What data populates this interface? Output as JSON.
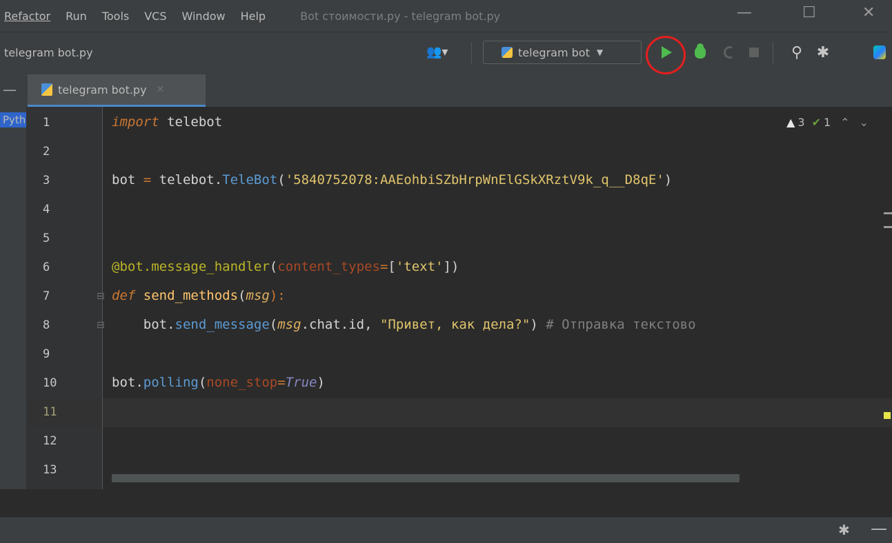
{
  "menu": {
    "items": [
      "Refactor",
      "Run",
      "Tools",
      "VCS",
      "Window",
      "Help"
    ],
    "window_title": "Bot стоимости.py - telegram bot.py",
    "minimize": "—",
    "maximize": "☐",
    "close": "✕"
  },
  "navbar": {
    "breadcrumb": "telegram bot.py",
    "run_config": "telegram bot",
    "run_config_caret": "▼"
  },
  "tabs": [
    {
      "label": "telegram bot.py",
      "close": "✕"
    }
  ],
  "sidebar": {
    "label": "Pytho"
  },
  "inspections": {
    "warnings": "3",
    "weak_warnings": "1"
  },
  "editor": {
    "line_numbers": [
      "1",
      "2",
      "3",
      "4",
      "5",
      "6",
      "7",
      "8",
      "9",
      "10",
      "11",
      "12",
      "13"
    ],
    "current_line": 11
  },
  "code": {
    "l1_kw": "import",
    "l1_mod": " telebot",
    "l3_a": "bot ",
    "l3_eq": "=",
    "l3_b": " telebot.",
    "l3_cls": "TeleBot",
    "l3_c": "(",
    "l3_str": "'5840752078:AAEohbiSZbHrpWnElGSkXRztV9k_q__D8qE'",
    "l3_d": ")",
    "l6_deco": "@bot.message_handler",
    "l6_a": "(",
    "l6_param": "content_types",
    "l6_eq": "=",
    "l6_b": "[",
    "l6_str": "'text'",
    "l6_c": "])",
    "l7_kw": "def",
    "l7_fn": " send_methods",
    "l7_a": "(",
    "l7_param": "msg",
    "l7_b": "):",
    "l8_a": "    bot.",
    "l8_fn": "send_message",
    "l8_b": "(",
    "l8_param": "msg",
    "l8_c": ".chat.id, ",
    "l8_str": "\"Привет, как дела?\"",
    "l8_d": ") ",
    "l8_comment": "# Отправка текстово",
    "l10_a": "bot.",
    "l10_fn": "polling",
    "l10_b": "(",
    "l10_param": "none_stop",
    "l10_eq": "=",
    "l10_bool": "True",
    "l10_c": ")"
  },
  "colors": {
    "background": "#2b2b2b",
    "annotation": "#e61e1e",
    "run_green": "#4fbb4f",
    "keyword": "#cc7832",
    "string": "#6a8759"
  },
  "icons": [
    "run-icon",
    "debug-icon",
    "coverage-icon",
    "stop-icon",
    "search-icon",
    "settings-icon",
    "plugin-icon",
    "user-icon",
    "gear-icon"
  ]
}
